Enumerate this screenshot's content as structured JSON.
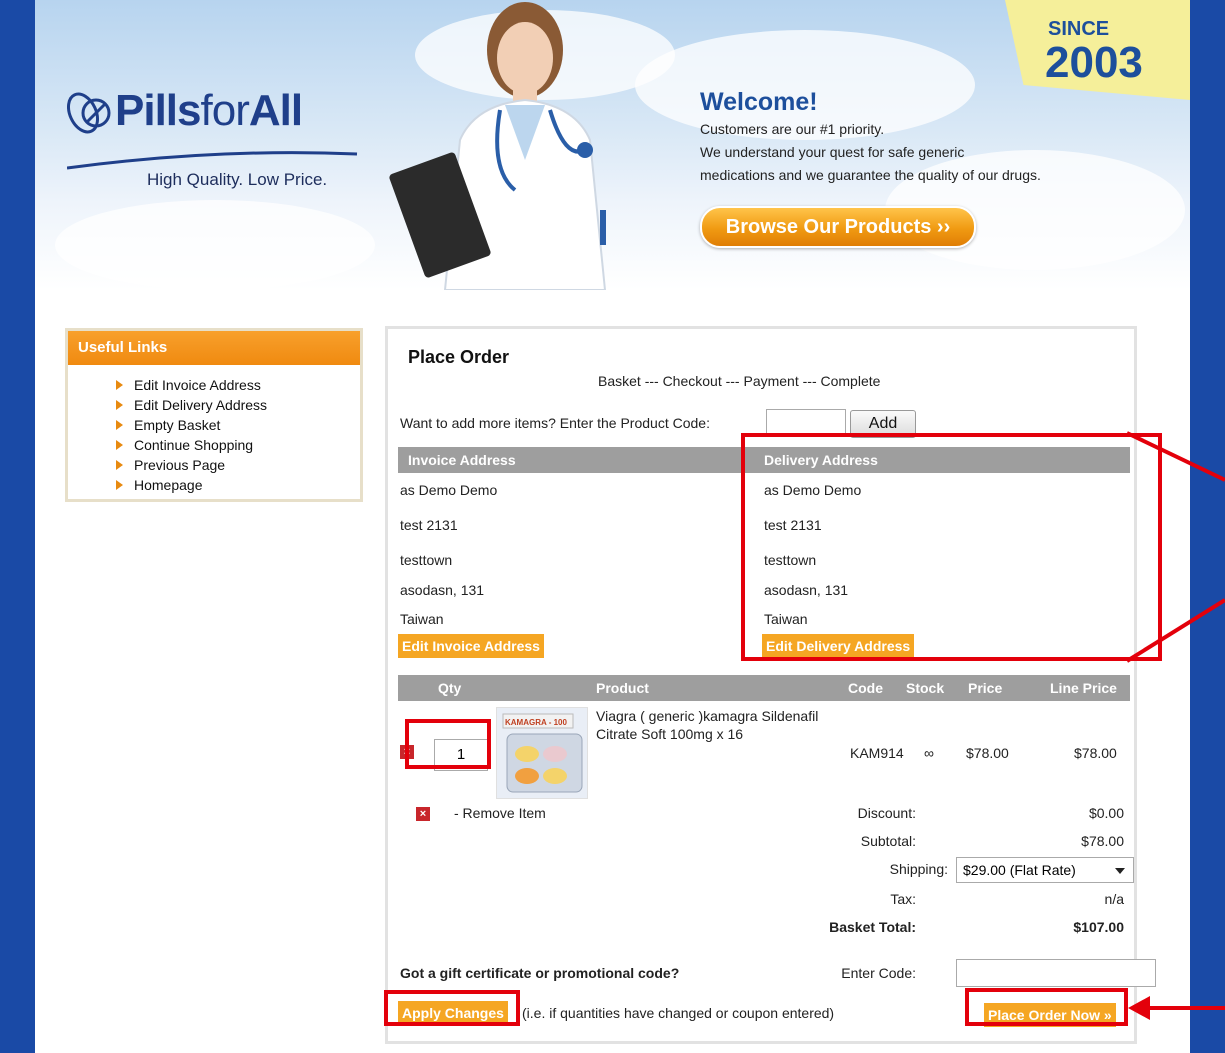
{
  "header": {
    "logo_pills": "Pills",
    "logo_for": "for",
    "logo_all": "All",
    "logo_tagline": "High Quality. Low Price.",
    "since_label": "SINCE",
    "since_year": "2003",
    "welcome_title": "Welcome!",
    "welcome_lines": [
      "Customers are our #1 priority.",
      "We understand your quest for safe generic",
      "medications and we guarantee the quality of our drugs."
    ],
    "browse_button": "Browse Our Products ››"
  },
  "sidebar": {
    "title": "Useful Links",
    "items": [
      "Edit Invoice Address",
      "Edit Delivery Address",
      "Empty Basket",
      "Continue Shopping",
      "Previous Page",
      "Homepage"
    ]
  },
  "order": {
    "title": "Place Order",
    "steps": "Basket --- Checkout --- Payment --- Complete",
    "add_prompt": "Want to add more items? Enter the Product Code:",
    "add_button": "Add",
    "invoice": {
      "heading": "Invoice Address",
      "name": "as Demo Demo",
      "street": "test 2131",
      "town": "testtown",
      "region": "asodasn, 131",
      "country": "Taiwan",
      "edit_button": "Edit Invoice Address"
    },
    "delivery": {
      "heading": "Delivery Address",
      "name": "as Demo Demo",
      "street": "test 2131",
      "town": "testtown",
      "region": "asodasn, 131",
      "country": "Taiwan",
      "edit_button": "Edit Delivery Address"
    },
    "table_headers": {
      "qty": "Qty",
      "product": "Product",
      "code": "Code",
      "stock": "Stock",
      "price": "Price",
      "line_price": "Line Price"
    },
    "item": {
      "qty": "1",
      "name": "Viagra ( generic )kamagra Sildenafil Citrate Soft 100mg x 16",
      "code": "KAM914",
      "stock": "∞",
      "price": "$78.00",
      "line_price": "$78.00",
      "image_label": "KAMAGRA - 100"
    },
    "remove_item": "- Remove Item",
    "discount_label": "Discount:",
    "discount_value": "$0.00",
    "subtotal_label": "Subtotal:",
    "subtotal_value": "$78.00",
    "shipping_label": "Shipping:",
    "shipping_selected": "$29.00 (Flat Rate)",
    "tax_label": "Tax:",
    "tax_value": "n/a",
    "total_label": "Basket Total:",
    "total_value": "$107.00",
    "gift_prompt": "Got a gift certificate or promotional code?",
    "enter_code_label": "Enter Code:",
    "apply_button": "Apply Changes",
    "apply_note": "(i.e. if quantities have changed or coupon entered)",
    "place_order_button": "Place Order Now »"
  },
  "colors": {
    "accent_orange": "#f5a623",
    "header_blue": "#1d4f9c",
    "annotation_red": "#e3000b",
    "table_header_gray": "#9e9e9e"
  }
}
